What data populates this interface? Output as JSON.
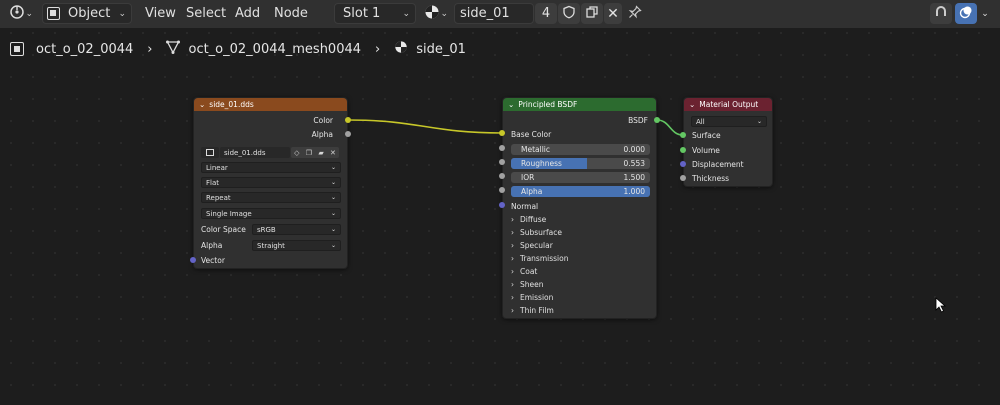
{
  "header": {
    "editor_type_icon": "node-editor-icon",
    "object_mode": "Object",
    "menus": [
      "View",
      "Select",
      "Add",
      "Node"
    ],
    "slot": "Slot 1",
    "material_name": "side_01",
    "user_count": "4",
    "icons": [
      "shield-icon",
      "duplicate-icon",
      "close-icon",
      "pin-icon",
      "snap-icon",
      "overlay-icon"
    ]
  },
  "breadcrumb": {
    "object": "oct_o_02_0044",
    "mesh": "oct_o_02_0044_mesh0044",
    "material": "side_01"
  },
  "image_node": {
    "title": "side_01.dds",
    "outputs": [
      "Color",
      "Alpha"
    ],
    "image_name": "side_01.dds",
    "interpolation": "Linear",
    "projection": "Flat",
    "extension": "Repeat",
    "source": "Single Image",
    "color_space_label": "Color Space",
    "color_space": "sRGB",
    "alpha_label": "Alpha",
    "alpha_mode": "Straight",
    "input": "Vector"
  },
  "bsdf_node": {
    "title": "Principled BSDF",
    "output": "BSDF",
    "base_color": "Base Color",
    "metallic_label": "Metallic",
    "metallic": "0.000",
    "roughness_label": "Roughness",
    "roughness": "0.553",
    "roughness_fill": 0.553,
    "ior_label": "IOR",
    "ior": "1.500",
    "alpha_label": "Alpha",
    "alpha": "1.000",
    "alpha_fill": 1.0,
    "normal": "Normal",
    "panels": [
      "Diffuse",
      "Subsurface",
      "Specular",
      "Transmission",
      "Coat",
      "Sheen",
      "Emission",
      "Thin Film"
    ]
  },
  "output_node": {
    "title": "Material Output",
    "target": "All",
    "inputs": [
      "Surface",
      "Volume",
      "Displacement",
      "Thickness"
    ]
  },
  "colors": {
    "image_header": "#8a4a1e",
    "bsdf_header": "#2c6b2f",
    "output_header": "#6b2230",
    "socket_color": "#c7c729",
    "socket_gray": "#a1a1a1",
    "socket_vector": "#6363c7",
    "socket_shader": "#63c763",
    "accent_blue": "#4772b3"
  }
}
